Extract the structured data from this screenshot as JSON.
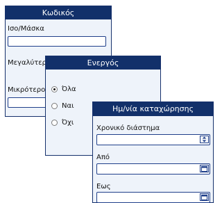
{
  "code_panel": {
    "title": "Κωδικός",
    "label_equal": "Ισο/Μάσκα",
    "label_greater": "Μεγαλύτερο",
    "label_less": "Μικρότερο"
  },
  "active_panel": {
    "title": "Ενεργός",
    "options": [
      {
        "label": "Όλα",
        "checked": true
      },
      {
        "label": "Ναι",
        "checked": false
      },
      {
        "label": "Όχι",
        "checked": false
      }
    ]
  },
  "date_panel": {
    "title": "Ημ/νία καταχώρησης",
    "label_period": "Χρονικό διάστημα",
    "label_from": "Από",
    "label_to": "Εως",
    "period_button_icon": "spinner-arrows-icon",
    "date_button_icon": "calendar-icon"
  },
  "colors": {
    "header_bg": "#12306a",
    "panel_bg": "#eef3fa",
    "input_border": "#1f3f8a"
  }
}
